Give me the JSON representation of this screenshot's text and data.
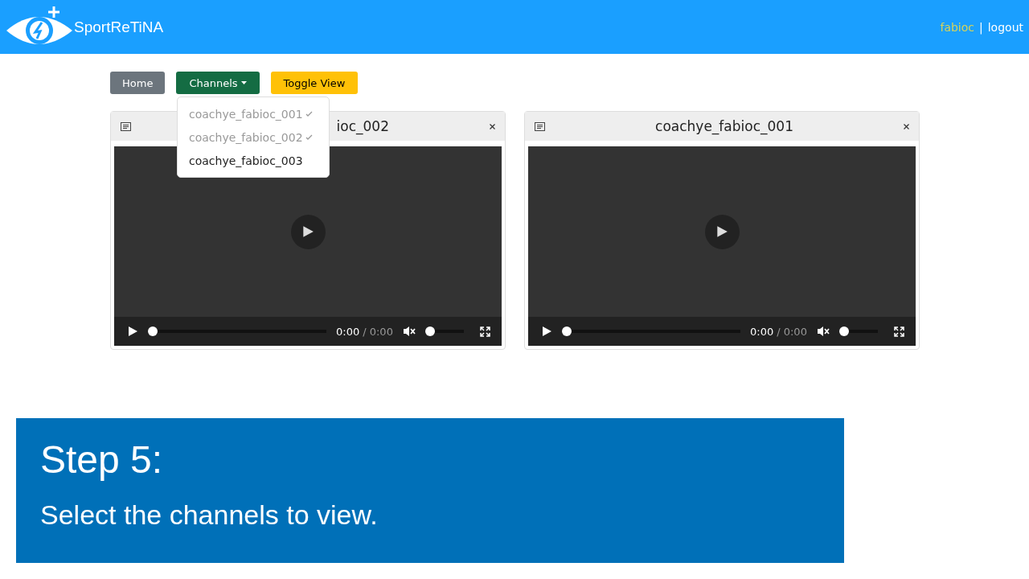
{
  "header": {
    "logo_text": "SportReTiNA",
    "user": "fabioc",
    "separator": "|",
    "logout": "logout"
  },
  "toolbar": {
    "buttons": [
      {
        "label": "Home",
        "kind": "home"
      },
      {
        "label": "Channels",
        "kind": "dropdown"
      },
      {
        "label": "Toggle View",
        "kind": "toggle"
      }
    ]
  },
  "channels_menu": {
    "items": [
      {
        "label": "coachye_fabioc_001",
        "checked": true
      },
      {
        "label": "coachye_fabioc_002",
        "checked": true
      },
      {
        "label": "coachye_fabioc_003",
        "checked": false
      }
    ]
  },
  "players": [
    {
      "title": "ioc_002",
      "title_partly_covered": true,
      "time": "0:00",
      "duration": "/ 0:00",
      "muted": true,
      "progress": {
        "level": 0
      },
      "volume": {
        "level": 0
      }
    },
    {
      "title": "coachye_fabioc_001",
      "title_partly_covered": false,
      "time": "0:00",
      "duration": "/ 0:00",
      "muted": true,
      "progress": {
        "level": 0
      },
      "volume": {
        "level": 0
      }
    }
  ],
  "banner": {
    "heading": "Step 5:",
    "text": "Select the channels to view."
  }
}
